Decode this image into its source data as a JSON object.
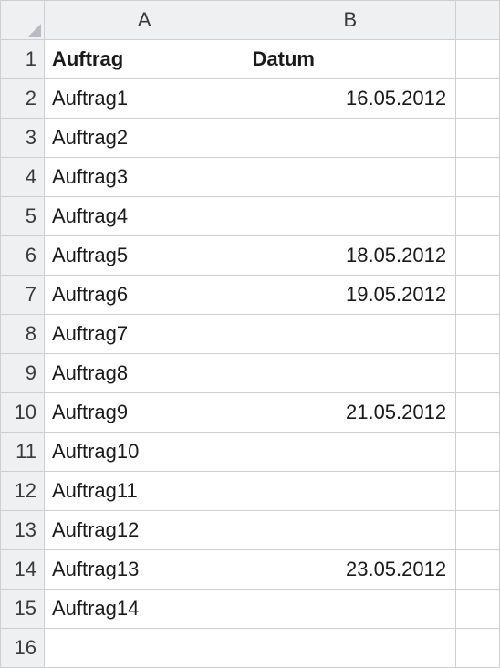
{
  "columns": {
    "A": "A",
    "B": "B"
  },
  "row_numbers": [
    "1",
    "2",
    "3",
    "4",
    "5",
    "6",
    "7",
    "8",
    "9",
    "10",
    "11",
    "12",
    "13",
    "14",
    "15",
    "16"
  ],
  "header_row": {
    "A": "Auftrag",
    "B": "Datum"
  },
  "rows": [
    {
      "A": "Auftrag1",
      "B": "16.05.2012"
    },
    {
      "A": "Auftrag2",
      "B": ""
    },
    {
      "A": "Auftrag3",
      "B": ""
    },
    {
      "A": "Auftrag4",
      "B": ""
    },
    {
      "A": "Auftrag5",
      "B": "18.05.2012"
    },
    {
      "A": "Auftrag6",
      "B": "19.05.2012"
    },
    {
      "A": "Auftrag7",
      "B": ""
    },
    {
      "A": "Auftrag8",
      "B": ""
    },
    {
      "A": "Auftrag9",
      "B": "21.05.2012"
    },
    {
      "A": "Auftrag10",
      "B": ""
    },
    {
      "A": "Auftrag11",
      "B": ""
    },
    {
      "A": "Auftrag12",
      "B": ""
    },
    {
      "A": "Auftrag13",
      "B": "23.05.2012"
    },
    {
      "A": "Auftrag14",
      "B": ""
    },
    {
      "A": "",
      "B": ""
    }
  ]
}
